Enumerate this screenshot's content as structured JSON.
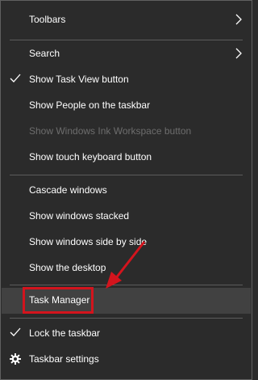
{
  "menu": {
    "items": [
      {
        "label": "Toolbars",
        "checked": false,
        "submenu": true,
        "disabled": false
      },
      {
        "label": "Search",
        "checked": false,
        "submenu": true,
        "disabled": false
      },
      {
        "label": "Show Task View button",
        "checked": true,
        "submenu": false,
        "disabled": false
      },
      {
        "label": "Show People on the taskbar",
        "checked": false,
        "submenu": false,
        "disabled": false
      },
      {
        "label": "Show Windows Ink Workspace button",
        "checked": false,
        "submenu": false,
        "disabled": true
      },
      {
        "label": "Show touch keyboard button",
        "checked": false,
        "submenu": false,
        "disabled": false
      },
      {
        "label": "Cascade windows",
        "checked": false,
        "submenu": false,
        "disabled": false
      },
      {
        "label": "Show windows stacked",
        "checked": false,
        "submenu": false,
        "disabled": false
      },
      {
        "label": "Show windows side by side",
        "checked": false,
        "submenu": false,
        "disabled": false
      },
      {
        "label": "Show the desktop",
        "checked": false,
        "submenu": false,
        "disabled": false
      },
      {
        "label": "Task Manager",
        "checked": false,
        "submenu": false,
        "disabled": false,
        "hovered": true
      },
      {
        "label": "Lock the taskbar",
        "checked": true,
        "submenu": false,
        "disabled": false
      },
      {
        "label": "Taskbar settings",
        "icon": "gear-icon",
        "checked": false,
        "submenu": false,
        "disabled": false
      }
    ]
  },
  "colors": {
    "menu_background": "#2b2b2b",
    "text": "#ffffff",
    "disabled_text": "#6d6d6d",
    "hover_background": "#414141",
    "annotation_red": "#d3141d"
  }
}
